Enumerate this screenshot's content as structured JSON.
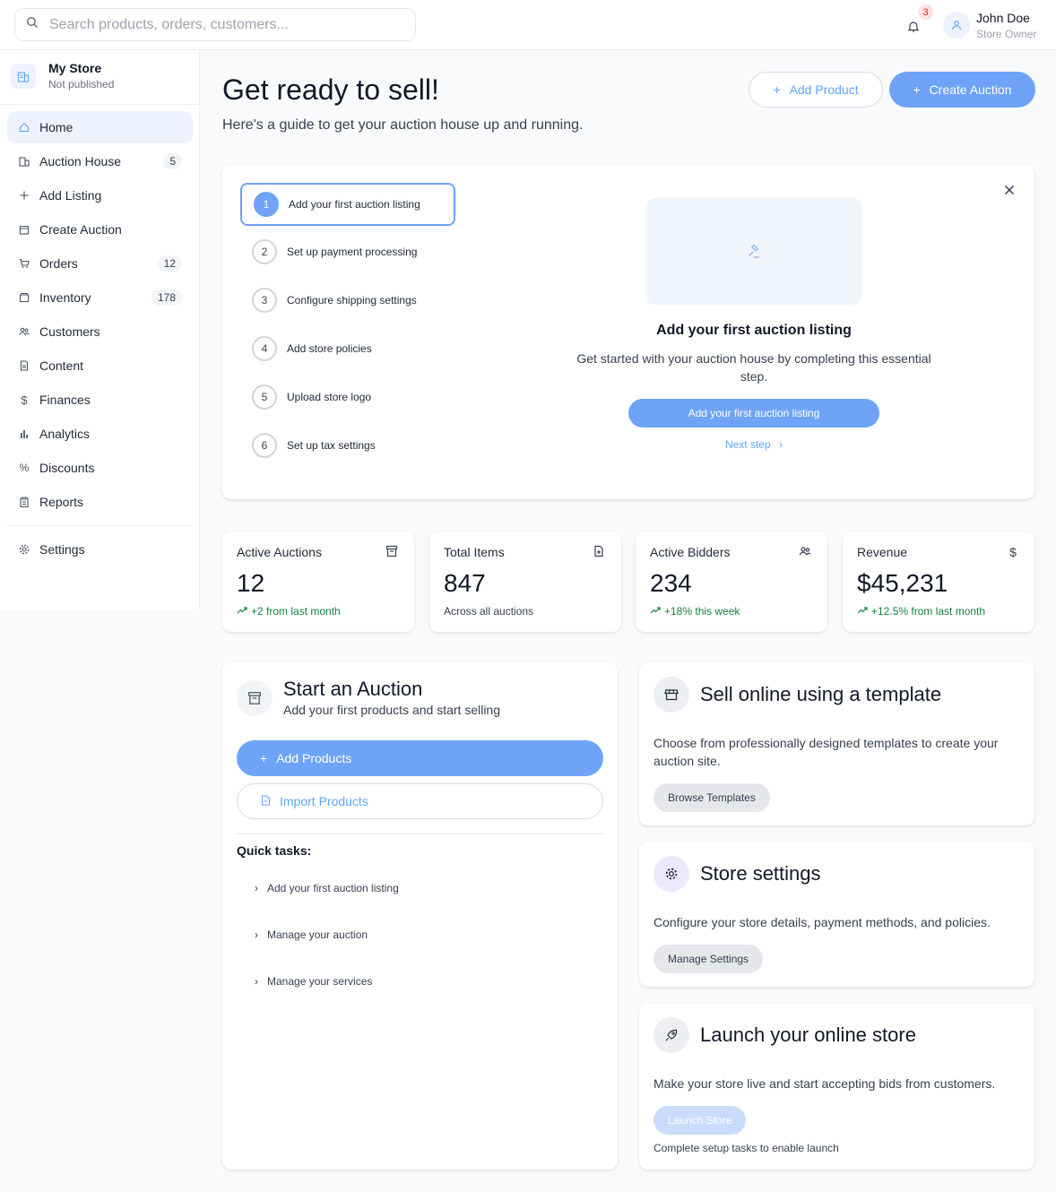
{
  "search": {
    "placeholder": "Search products, orders, customers..."
  },
  "header": {
    "notifications": "3",
    "user_name": "John Doe",
    "user_role": "Store Owner"
  },
  "store": {
    "name": "My Store",
    "status": "Not published"
  },
  "sidebar": {
    "items": [
      {
        "label": "Home",
        "icon": "home-icon",
        "badge": ""
      },
      {
        "label": "Auction House",
        "icon": "building-icon",
        "badge": "5"
      },
      {
        "label": "Add Listing",
        "icon": "plus-icon",
        "badge": ""
      },
      {
        "label": "Create Auction",
        "icon": "calendar-icon",
        "badge": ""
      },
      {
        "label": "Orders",
        "icon": "cart-icon",
        "badge": "12"
      },
      {
        "label": "Inventory",
        "icon": "box-icon",
        "badge": "178"
      },
      {
        "label": "Customers",
        "icon": "users-icon",
        "badge": ""
      },
      {
        "label": "Content",
        "icon": "file-icon",
        "badge": ""
      },
      {
        "label": "Finances",
        "icon": "dollar-icon",
        "badge": ""
      },
      {
        "label": "Analytics",
        "icon": "bar-chart-icon",
        "badge": ""
      },
      {
        "label": "Discounts",
        "icon": "percent-icon",
        "badge": ""
      },
      {
        "label": "Reports",
        "icon": "clipboard-icon",
        "badge": ""
      }
    ],
    "settings": "Settings"
  },
  "page": {
    "title": "Get ready to sell!",
    "subtitle": "Here's a guide to get your auction house up and running.",
    "add_product": "Add Product",
    "create_auction": "Create Auction"
  },
  "guide": {
    "steps": [
      {
        "num": "1",
        "label": "Add your first auction listing"
      },
      {
        "num": "2",
        "label": "Set up payment processing"
      },
      {
        "num": "3",
        "label": "Configure shipping settings"
      },
      {
        "num": "4",
        "label": "Add store policies"
      },
      {
        "num": "5",
        "label": "Upload store logo"
      },
      {
        "num": "6",
        "label": "Set up tax settings"
      }
    ],
    "detail_title": "Add your first auction listing",
    "detail_desc": "Get started with your auction house by completing this essential step.",
    "detail_button": "Add your first auction listing",
    "next_step": "Next step"
  },
  "stats": [
    {
      "label": "Active Auctions",
      "value": "12",
      "sub": "+2 from last month",
      "trend": true
    },
    {
      "label": "Total Items",
      "value": "847",
      "sub": "Across all auctions",
      "trend": false
    },
    {
      "label": "Active Bidders",
      "value": "234",
      "sub": "+18% this week",
      "trend": true
    },
    {
      "label": "Revenue",
      "value": "$45,231",
      "sub": "+12.5% from last month",
      "trend": true
    }
  ],
  "auction": {
    "title": "Start an Auction",
    "subtitle": "Add your first products and start selling",
    "add_products": "Add Products",
    "import_products": "Import Products",
    "quick_tasks_title": "Quick tasks:",
    "quick_tasks": [
      "Add your first auction listing",
      "Manage your auction",
      "Manage your services"
    ]
  },
  "template": {
    "title": "Sell online using a template",
    "desc": "Choose from professionally designed templates to create your auction site.",
    "button": "Browse Templates"
  },
  "store_settings": {
    "title": "Store settings",
    "desc": "Configure your store details, payment methods, and policies.",
    "button": "Manage Settings"
  },
  "launch": {
    "title": "Launch your online store",
    "desc": "Make your store live and start accepting bids from customers.",
    "button": "Launch Store",
    "note": "Complete setup tasks to enable launch"
  },
  "colors": {
    "accent": "#6ea3f7",
    "link": "#60a5fa",
    "positive": "#15803d",
    "badge_red": "#dc2626"
  }
}
